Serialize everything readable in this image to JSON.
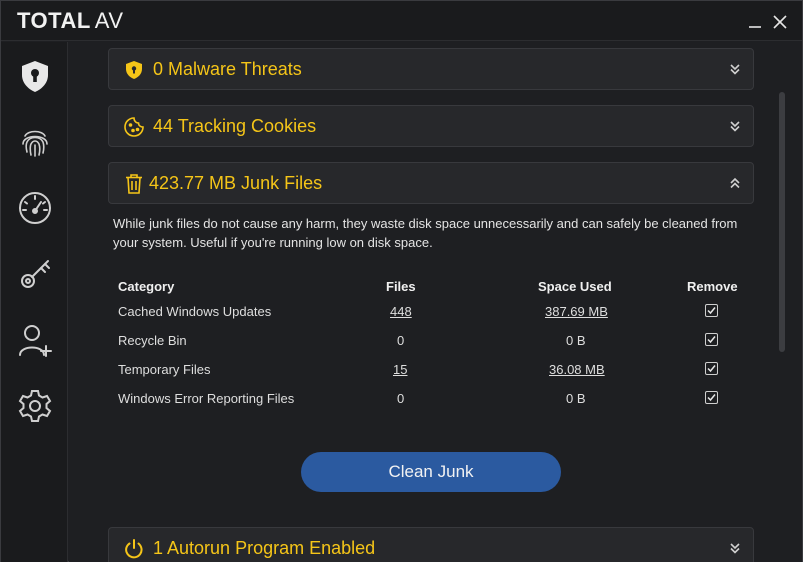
{
  "app": {
    "logo_bold": "TOTAL",
    "logo_regular": "AV",
    "minimize_glyph": "—",
    "close_glyph": "✕",
    "accent_color": "#f5c518",
    "button_color": "#2b5aa0"
  },
  "sidebar": {
    "items": [
      {
        "icon": "shield-lock-icon"
      },
      {
        "icon": "fingerprint-icon"
      },
      {
        "icon": "speedometer-icon"
      },
      {
        "icon": "key-icon"
      },
      {
        "icon": "add-user-icon"
      },
      {
        "icon": "gear-icon"
      }
    ]
  },
  "panels": {
    "malware": {
      "title": "0 Malware Threats",
      "icon": "shield-icon",
      "state": "collapsed"
    },
    "cookies": {
      "title": "44 Tracking Cookies",
      "icon": "cookie-icon",
      "state": "collapsed"
    },
    "junk": {
      "title": "423.77 MB Junk Files",
      "icon": "trash-icon",
      "state": "expanded"
    },
    "autorun": {
      "title": "1 Autorun Program Enabled",
      "icon": "power-icon",
      "state": "collapsed"
    }
  },
  "junk": {
    "description": "While junk files do not cause any harm, they waste disk space unnecessarily and can safely be cleaned from your system. Useful if you're running low on disk space.",
    "headers": {
      "category": "Category",
      "files": "Files",
      "space": "Space Used",
      "remove": "Remove"
    },
    "rows": [
      {
        "category": "Cached Windows Updates",
        "files": "448",
        "space": "387.69 MB",
        "remove": true,
        "linked": true
      },
      {
        "category": "Recycle Bin",
        "files": "0",
        "space": "0 B",
        "remove": true,
        "linked": false
      },
      {
        "category": "Temporary Files",
        "files": "15",
        "space": "36.08 MB",
        "remove": true,
        "linked": true
      },
      {
        "category": "Windows Error Reporting Files",
        "files": "0",
        "space": "0 B",
        "remove": true,
        "linked": false
      }
    ],
    "clean_button": "Clean Junk"
  }
}
